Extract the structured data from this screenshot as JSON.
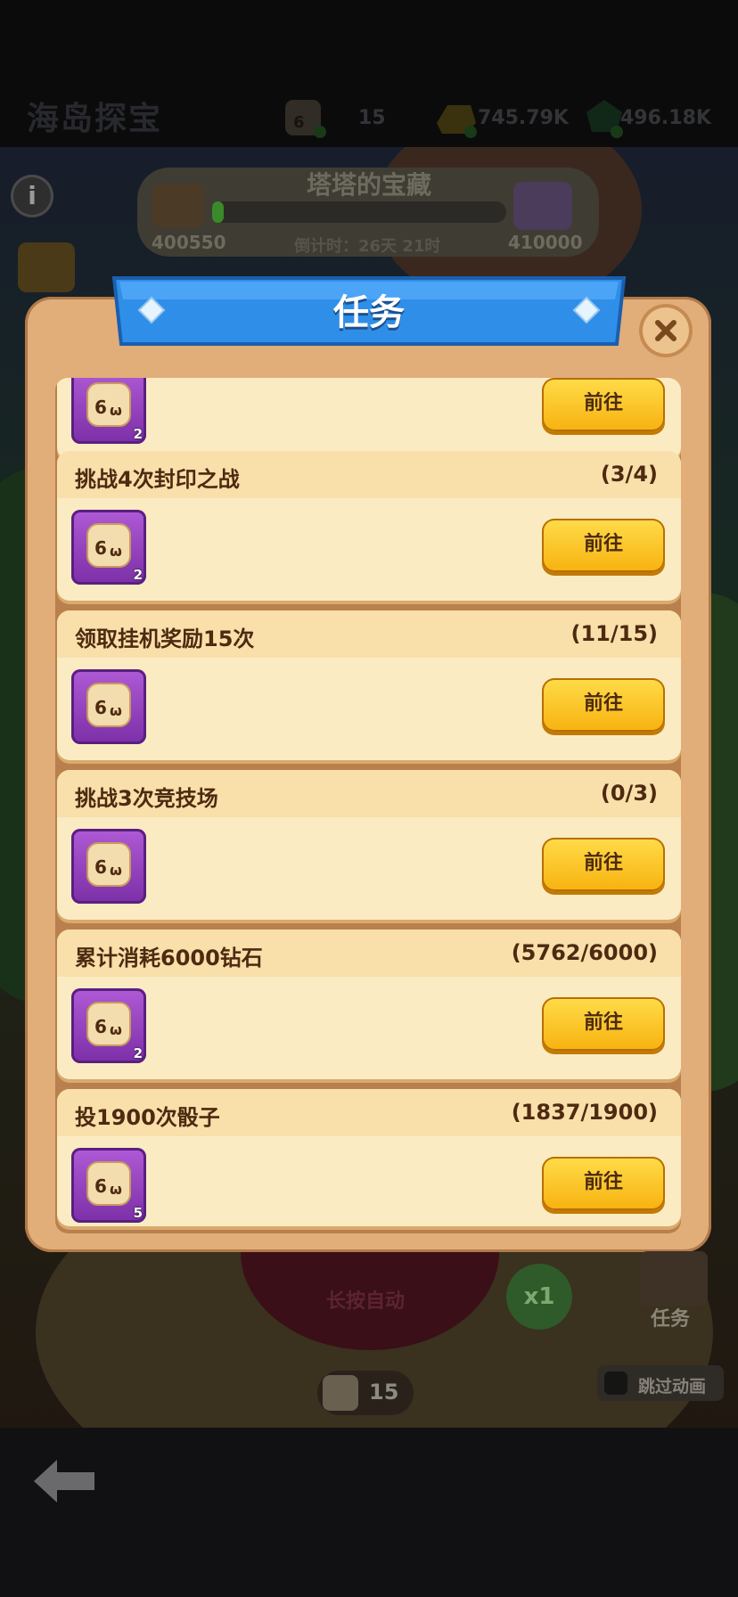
{
  "header": {
    "title": "海岛探宝",
    "dice_count": "15",
    "gold": "745.79K",
    "gems": "496.18K"
  },
  "event": {
    "title": "塔塔的宝藏",
    "left_score": "400550",
    "right_score": "410000",
    "countdown": "倒计时：26天 21时"
  },
  "modal": {
    "title": "任务",
    "go_label": "前往",
    "tasks": [
      {
        "name": "",
        "progress": "",
        "reward_count": "2"
      },
      {
        "name": "挑战4次封印之战",
        "progress": "(3/4)",
        "reward_count": "2"
      },
      {
        "name": "领取挂机奖励15次",
        "progress": "(11/15)",
        "reward_count": ""
      },
      {
        "name": "挑战3次竞技场",
        "progress": "(0/3)",
        "reward_count": ""
      },
      {
        "name": "累计消耗6000钻石",
        "progress": "(5762/6000)",
        "reward_count": "2"
      },
      {
        "name": "投1900次骰子",
        "progress": "(1837/1900)",
        "reward_count": "5"
      }
    ]
  },
  "scene": {
    "auto_label": "长按自动",
    "multiplier": "x1",
    "tasks_label": "任务",
    "skip_anim_label": "跳过动画",
    "bottom_dice": "15"
  },
  "colors": {
    "modal_bg": "#e1ad79",
    "ribbon": "#2f8fe8",
    "button": "#ffcc22",
    "reward_bg": "#9b45c8"
  }
}
